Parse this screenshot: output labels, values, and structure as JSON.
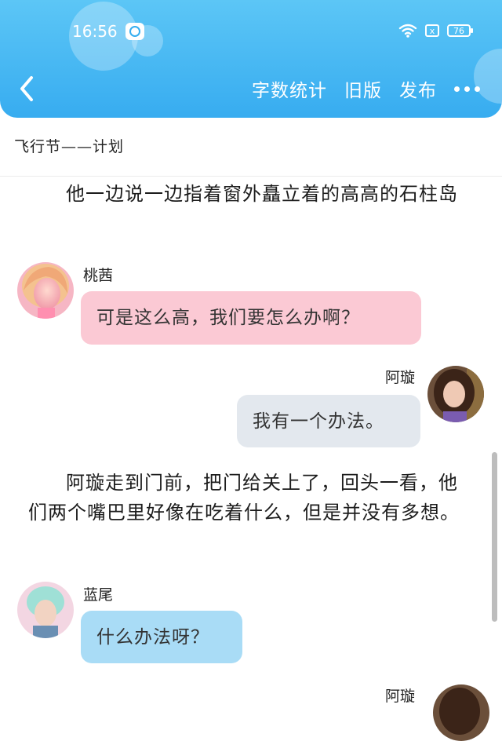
{
  "status_bar": {
    "time": "16:56",
    "battery": "76",
    "sim_icon": "x"
  },
  "header": {
    "back_icon": "chevron-left-icon",
    "actions": {
      "word_count": "字数统计",
      "old_version": "旧版",
      "publish": "发布"
    },
    "more_icon": "more-horizontal-icon"
  },
  "doc": {
    "title": "飞行节——计划"
  },
  "content": {
    "para1": "他一边说一边指着窗外矗立着的高高的石柱岛",
    "chat1": {
      "speaker": "桃茜",
      "text": "可是这么高，我们要怎么办啊？"
    },
    "chat2": {
      "speaker": "阿璇",
      "text": "我有一个办法。"
    },
    "para2": "阿璇走到门前，把门给关上了，回头一看，他们两个嘴巴里好像在吃着什么，但是并没有多想。",
    "chat3": {
      "speaker": "蓝尾",
      "text": "什么办法呀？"
    },
    "chat4": {
      "speaker": "阿璇"
    }
  },
  "colors": {
    "header": "#37acf0",
    "bubble_pink": "#fbc9d4",
    "bubble_gray": "#e3e8ee",
    "bubble_blue": "#a9dcf6"
  }
}
